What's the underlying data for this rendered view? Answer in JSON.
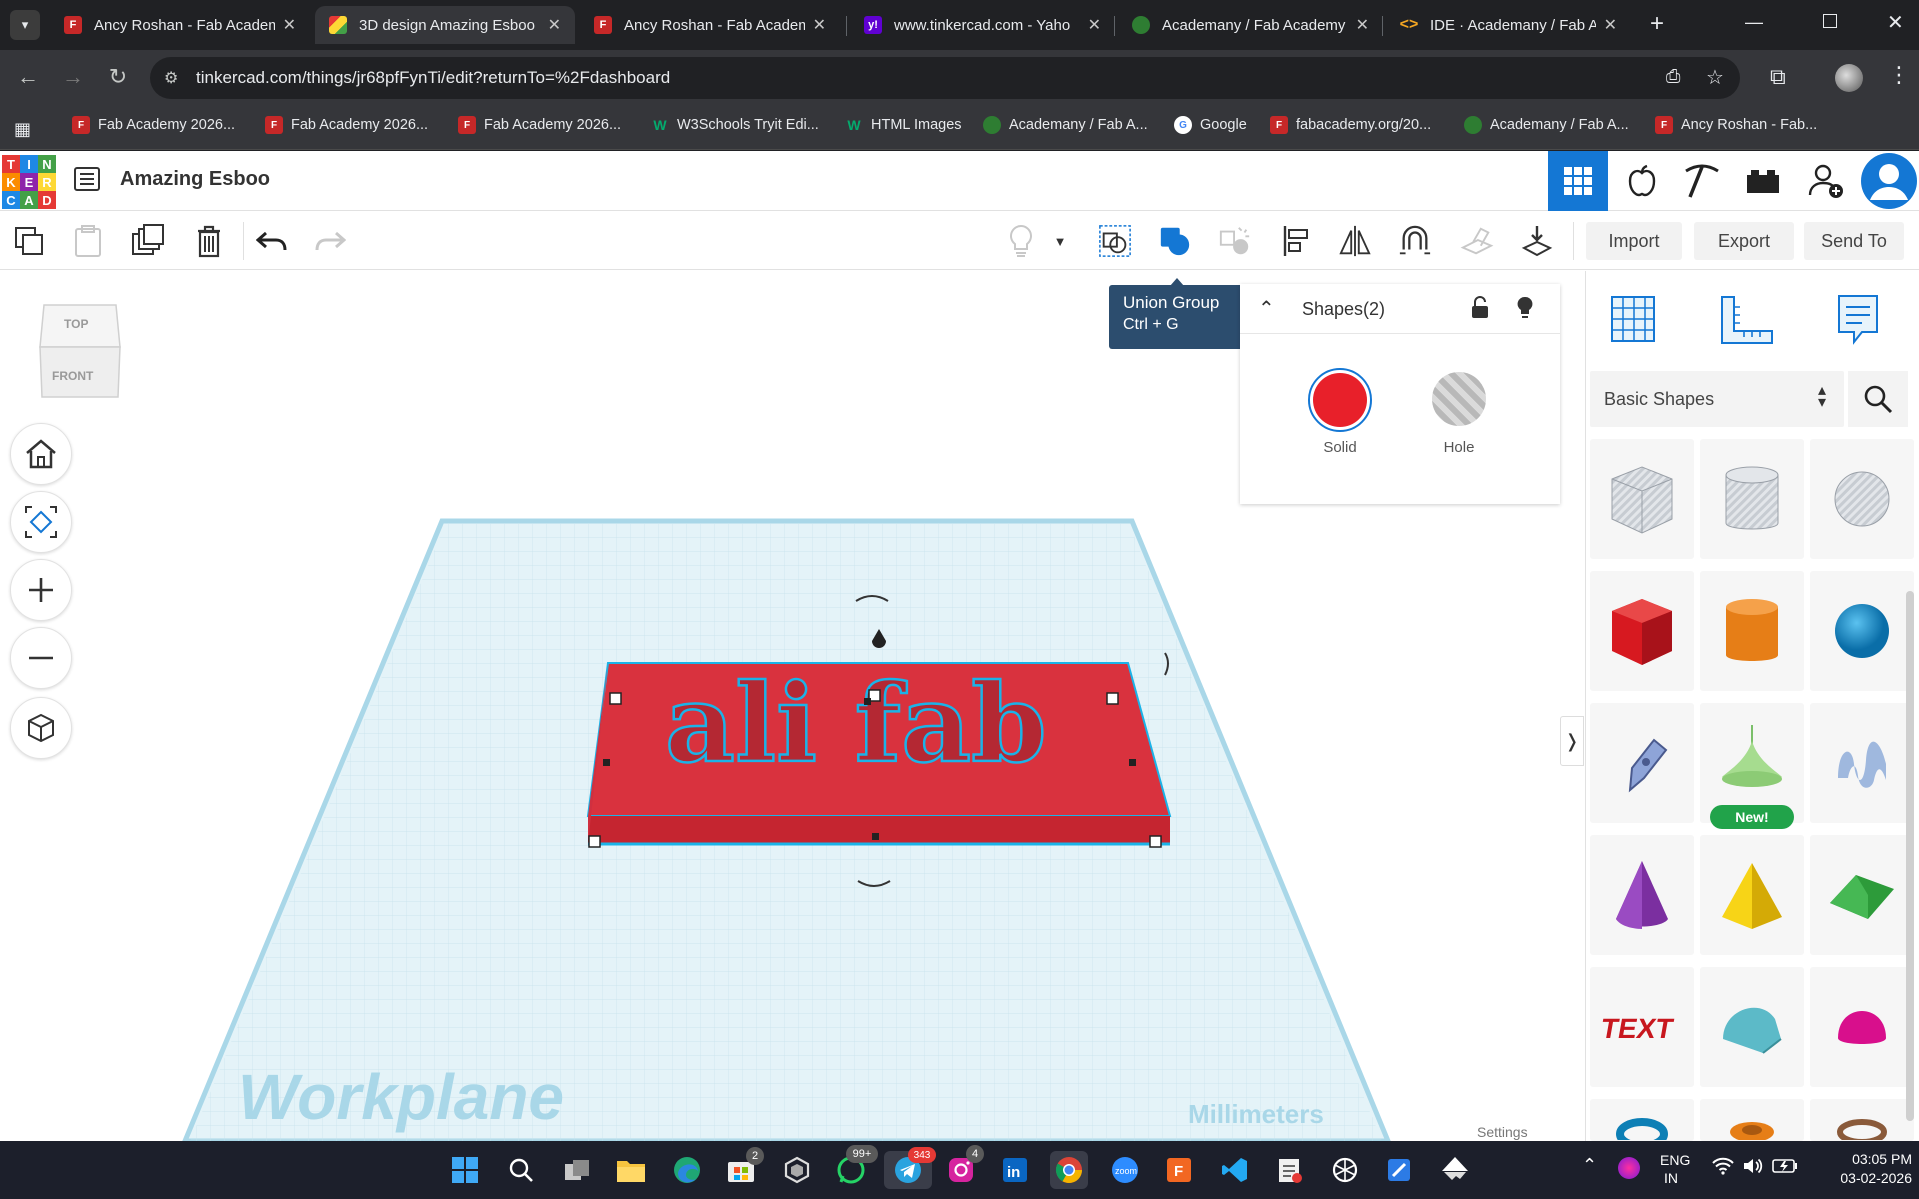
{
  "browser": {
    "tabs": [
      {
        "title": "Ancy Roshan - Fab Academ",
        "active": false
      },
      {
        "title": "3D design Amazing Esboo",
        "active": true
      },
      {
        "title": "Ancy Roshan - Fab Academ",
        "active": false
      },
      {
        "title": "www.tinkercad.com - Yaho",
        "active": false
      },
      {
        "title": "Academany / Fab Academy",
        "active": false
      },
      {
        "title": "IDE · Academany / Fab Aca",
        "active": false
      }
    ],
    "url": "tinkercad.com/things/jr68pfFynTi/edit?returnTo=%2Fdashboard",
    "bookmarks": [
      "Fab Academy 2026...",
      "Fab Academy 2026...",
      "Fab Academy 2026...",
      "W3Schools Tryit Edi...",
      "HTML Images",
      "Academany / Fab A...",
      "Google",
      "fabacademy.org/20...",
      "Academany / Fab A...",
      "Ancy Roshan - Fab..."
    ]
  },
  "app": {
    "logo_letters": [
      "T",
      "I",
      "N",
      "K",
      "E",
      "R",
      "C",
      "A",
      "D"
    ],
    "project_title": "Amazing Esboo",
    "toolbar": {
      "import_label": "Import",
      "export_label": "Export",
      "send_to_label": "Send To"
    },
    "viewcube": {
      "top": "TOP",
      "front": "FRONT"
    },
    "tooltip": {
      "title": "Union Group",
      "shortcut": "Ctrl + G"
    },
    "inspector": {
      "title": "Shapes(2)",
      "solid_label": "Solid",
      "hole_label": "Hole",
      "solid_color": "#e8202a"
    },
    "workplane": {
      "label": "Workplane",
      "units": "Millimeters",
      "object_text": "ali fab"
    },
    "right_panel": {
      "category": "Basic Shapes",
      "new_badge": "New!",
      "settings_label": "Settings"
    }
  },
  "taskbar": {
    "badges": {
      "gallery": "2",
      "whatsapp": "99+",
      "telegram": "343",
      "instagram": "4"
    },
    "language": "ENG",
    "region": "IN",
    "time": "03:05 PM",
    "date": "03-02-2026"
  }
}
